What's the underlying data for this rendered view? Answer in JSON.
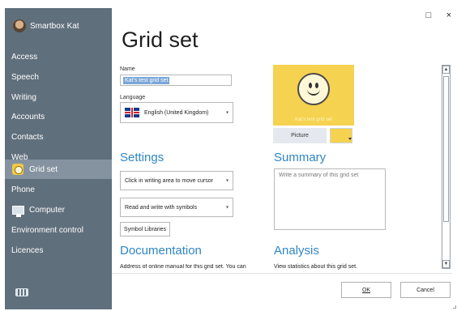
{
  "window": {
    "title": "Grid set",
    "controls": {
      "minimize": "□",
      "close": "×"
    }
  },
  "sidebar": {
    "user_name": "Smartbox Kat",
    "items": [
      {
        "label": "Access",
        "icon": "",
        "active": false
      },
      {
        "label": "Speech",
        "icon": "",
        "active": false
      },
      {
        "label": "Writing",
        "icon": "",
        "active": false
      },
      {
        "label": "Accounts",
        "icon": "",
        "active": false
      },
      {
        "label": "Contacts",
        "icon": "",
        "active": false
      },
      {
        "label": "Web",
        "icon": "",
        "active": false
      },
      {
        "label": "Grid set",
        "icon": "grid-set-smiley-icon",
        "active": true
      },
      {
        "label": "Phone",
        "icon": "",
        "active": false
      },
      {
        "label": "Computer",
        "icon": "computer-icon",
        "active": false
      },
      {
        "label": "Environment control",
        "icon": "",
        "active": false
      },
      {
        "label": "Licences",
        "icon": "",
        "active": false
      }
    ],
    "bottom_icon": "keyboard-icon"
  },
  "form": {
    "name_label": "Name",
    "name_value": "Kat's test grid set",
    "language_label": "Language",
    "language_value": "English (United Kingdom)",
    "language_flag": "uk-flag-icon"
  },
  "preview": {
    "caption": "Kat's test grid set",
    "picture_button": "Picture",
    "color": "#F5D24F",
    "symbol": "smiley-face-icon"
  },
  "settings": {
    "heading": "Settings",
    "writing_area_option": "Click in writing area to move cursor",
    "symbol_option": "Read and write with symbols",
    "symbol_libraries_button": "Symbol Libraries"
  },
  "summary": {
    "heading": "Summary",
    "placeholder": "Write a summary of this grid set"
  },
  "documentation": {
    "heading": "Documentation",
    "text": "Address of online manual for this grid set. You can"
  },
  "analysis": {
    "heading": "Analysis",
    "text": "View statistics about this grid set."
  },
  "footer": {
    "ok": "OK",
    "cancel": "Cancel"
  },
  "colors": {
    "sidebar": "#606F7C",
    "active_item": "#8593A0",
    "accent": "#2F86C4",
    "preview_background": "#F5D24F"
  }
}
